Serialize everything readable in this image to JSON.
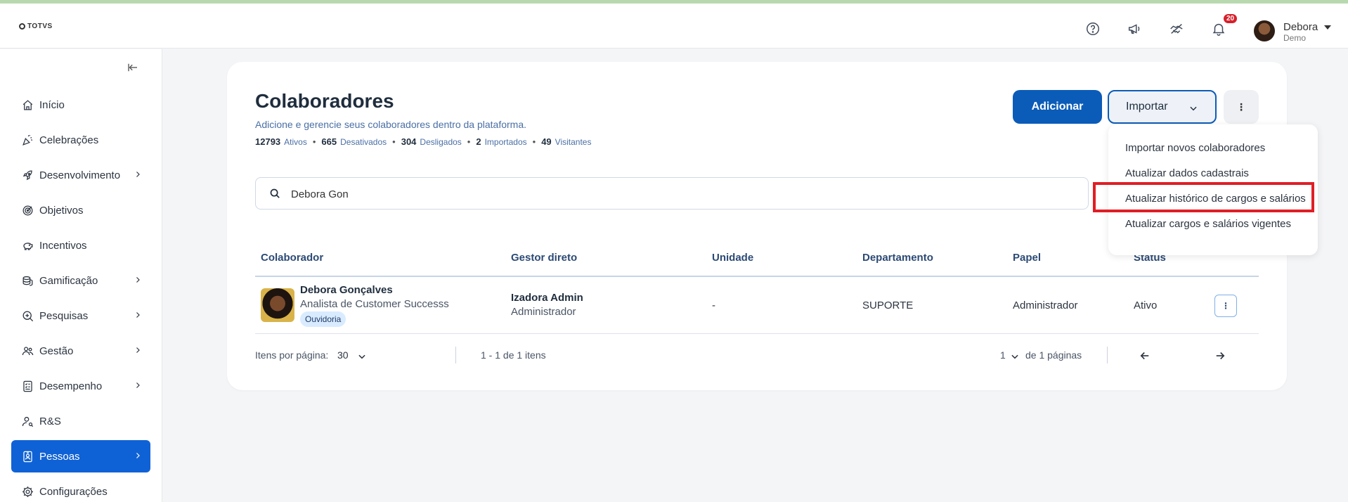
{
  "app": {
    "logo_text": "TOTVS"
  },
  "topbar": {
    "notification_count": "20",
    "user_name": "Debora",
    "user_role": "Demo",
    "icons": [
      "help-icon",
      "megaphone-icon",
      "handshake-icon",
      "bell-icon"
    ]
  },
  "sidebar": {
    "items": [
      {
        "label": "Início",
        "icon": "home-icon",
        "has_children": false,
        "active": false
      },
      {
        "label": "Celebrações",
        "icon": "party-icon",
        "has_children": false,
        "active": false
      },
      {
        "label": "Desenvolvimento",
        "icon": "rocket-icon",
        "has_children": true,
        "active": false
      },
      {
        "label": "Objetivos",
        "icon": "target-icon",
        "has_children": false,
        "active": false
      },
      {
        "label": "Incentivos",
        "icon": "piggy-bank-icon",
        "has_children": false,
        "active": false
      },
      {
        "label": "Gamificação",
        "icon": "coins-icon",
        "has_children": true,
        "active": false
      },
      {
        "label": "Pesquisas",
        "icon": "search-survey-icon",
        "has_children": true,
        "active": false
      },
      {
        "label": "Gestão",
        "icon": "people-icon",
        "has_children": true,
        "active": false
      },
      {
        "label": "Desempenho",
        "icon": "checklist-icon",
        "has_children": true,
        "active": false
      },
      {
        "label": "R&S",
        "icon": "user-search-icon",
        "has_children": false,
        "active": false
      },
      {
        "label": "Pessoas",
        "icon": "id-badge-icon",
        "has_children": true,
        "active": true
      },
      {
        "label": "Configurações",
        "icon": "gear-icon",
        "has_children": false,
        "active": false
      }
    ]
  },
  "page": {
    "title": "Colaboradores",
    "subtitle": "Adicione e gerencie seus colaboradores dentro da plataforma.",
    "stats": {
      "ativos_count": "12793",
      "ativos_label": "Ativos",
      "desativados_count": "665",
      "desativados_label": "Desativados",
      "desligados_count": "304",
      "desligados_label": "Desligados",
      "importados_count": "2",
      "importados_label": "Importados",
      "visitantes_count": "49",
      "visitantes_label": "Visitantes"
    },
    "add_label": "Adicionar",
    "import_label": "Importar"
  },
  "import_menu": {
    "items": [
      "Importar novos colaboradores",
      "Atualizar dados cadastrais",
      "Atualizar histórico de cargos e salários",
      "Atualizar cargos e salários vigentes"
    ]
  },
  "search": {
    "value": "Debora Gon"
  },
  "table": {
    "headers": {
      "colaborador": "Colaborador",
      "gestor": "Gestor direto",
      "unidade": "Unidade",
      "departamento": "Departamento",
      "papel": "Papel",
      "status": "Status"
    },
    "rows": [
      {
        "name": "Debora Gonçalves",
        "role": "Analista de Customer Successs",
        "tag": "Ouvidoria",
        "manager_name": "Izadora Admin",
        "manager_role": "Administrador",
        "unidade": "-",
        "departamento": "SUPORTE",
        "papel": "Administrador",
        "status": "Ativo"
      }
    ]
  },
  "pagination": {
    "per_page_label": "Itens por página:",
    "per_page_value": "30",
    "range_text": "1 - 1 de 1 itens",
    "current_page": "1",
    "total_pages_text": "de 1 páginas"
  },
  "colors": {
    "primary": "#0b5cb8",
    "active_nav": "#0f62d6",
    "highlight": "#e01e26"
  }
}
